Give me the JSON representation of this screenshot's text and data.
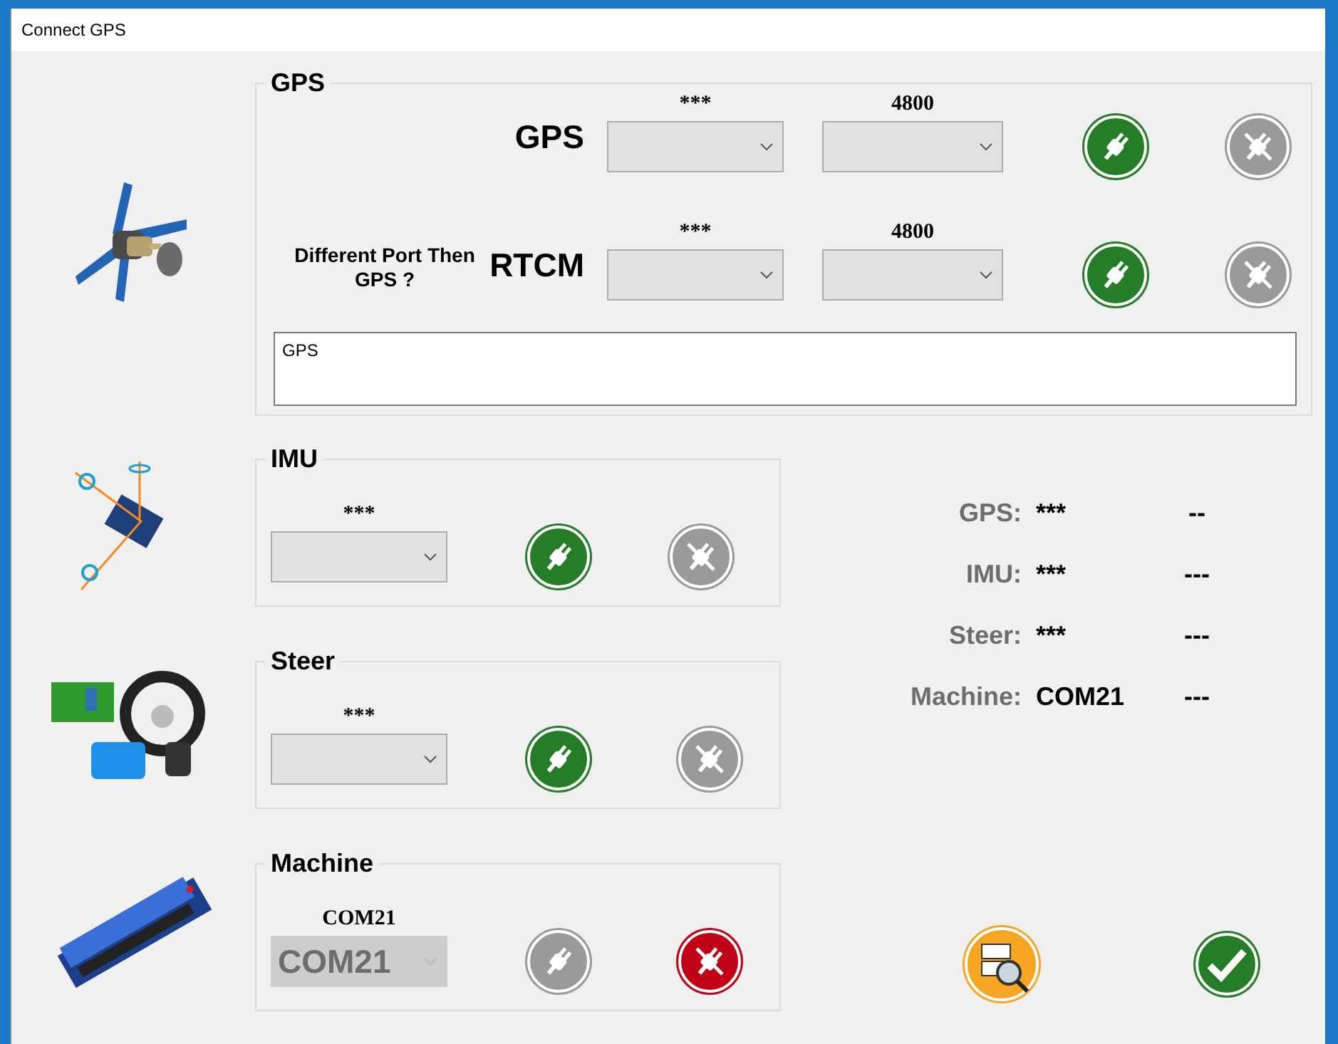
{
  "window": {
    "title": "Connect GPS"
  },
  "gps": {
    "title": "GPS",
    "ports": [
      {
        "label": "GPS",
        "port": {
          "caption": "***",
          "disabled": false
        },
        "baud": {
          "caption": "4800",
          "disabled": false
        },
        "connect": {
          "enabled": true
        },
        "disconnect": {
          "enabled": false
        }
      },
      {
        "hint": "Different Port Then GPS ?",
        "label": "RTCM",
        "port": {
          "caption": "***",
          "disabled": false
        },
        "baud": {
          "caption": "4800",
          "disabled": false
        },
        "connect": {
          "enabled": true
        },
        "disconnect": {
          "enabled": false
        }
      }
    ],
    "log": "GPS"
  },
  "devices": [
    {
      "kind": "imu",
      "title": "IMU",
      "port": {
        "caption": "***",
        "disabled": false
      },
      "connect": {
        "enabled": true
      },
      "disconnect": {
        "enabled": false
      }
    },
    {
      "kind": "steer",
      "title": "Steer",
      "port": {
        "caption": "***",
        "disabled": false
      },
      "connect": {
        "enabled": true
      },
      "disconnect": {
        "enabled": false
      }
    },
    {
      "kind": "machine",
      "title": "Machine",
      "port": {
        "caption": "COM21",
        "value": "COM21",
        "disabled": true
      },
      "connect": {
        "enabled": false
      },
      "disconnect": {
        "enabled": true
      }
    }
  ],
  "status": [
    {
      "label": "GPS:",
      "port": "***",
      "state": "--"
    },
    {
      "label": "IMU:",
      "port": "***",
      "state": "---"
    },
    {
      "label": "Steer:",
      "port": "***",
      "state": "---"
    },
    {
      "label": "Machine:",
      "port": "COM21",
      "state": "---"
    }
  ],
  "buttons": [
    {
      "kind": "search"
    },
    {
      "kind": "ok"
    }
  ]
}
